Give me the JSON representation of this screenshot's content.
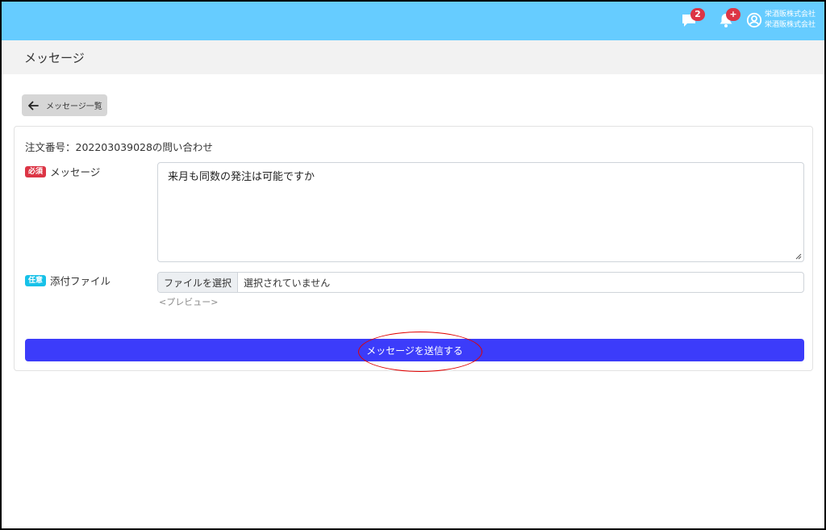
{
  "header": {
    "messages_badge": "2",
    "notifications_badge": "+",
    "user_line1": "栄酒販株式会社",
    "user_line2": "栄酒販株式会社",
    "bg_color": "#66ccff"
  },
  "page": {
    "title": "メッセージ"
  },
  "back_button": {
    "label": "メッセージ一覧"
  },
  "form": {
    "order_title": "注文番号：202203039028の問い合わせ",
    "message": {
      "required_tag": "必須",
      "label": "メッセージ",
      "value": "来月も同数の発注は可能ですか"
    },
    "attachment": {
      "optional_tag": "任意",
      "label": "添付ファイル",
      "choose_button": "ファイルを選択",
      "status": "選択されていません",
      "preview": "<プレビュー>"
    },
    "submit_label": "メッセージを送信する",
    "submit_color": "#3c3cfa"
  }
}
